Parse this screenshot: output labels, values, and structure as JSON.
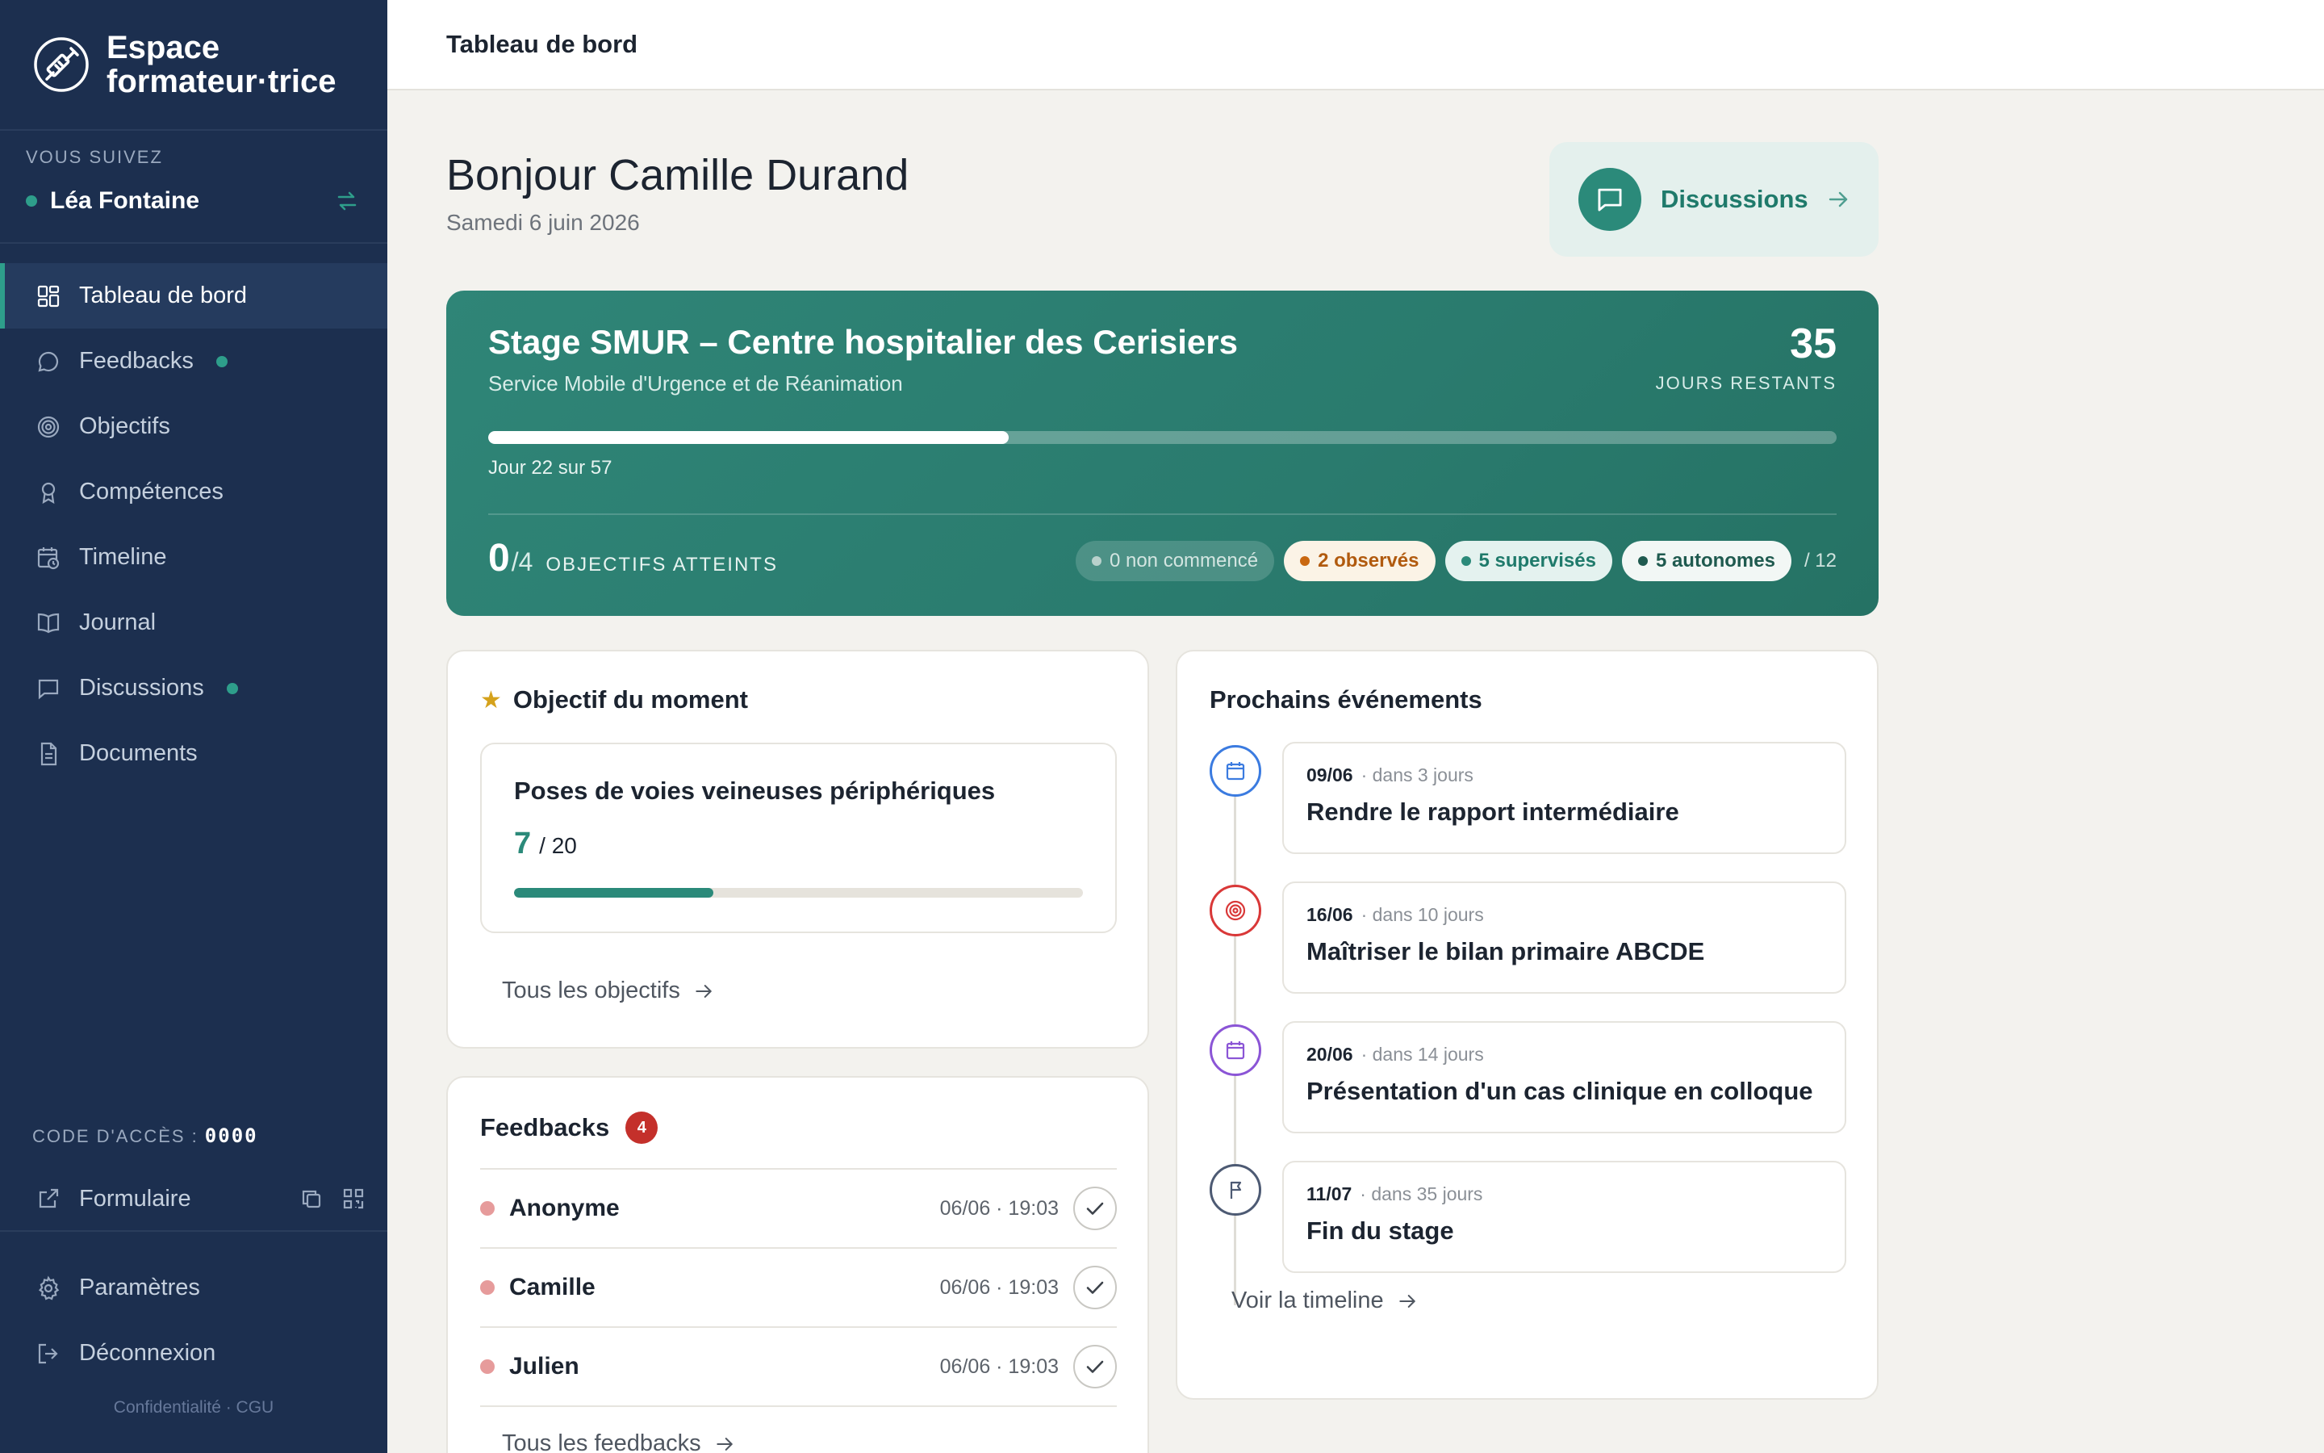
{
  "brand": {
    "line1": "Espace",
    "line2": "formateur·trice"
  },
  "follow": {
    "label": "VOUS SUIVEZ",
    "name": "Léa Fontaine"
  },
  "nav": [
    {
      "label": "Tableau de bord",
      "icon": "grid-icon"
    },
    {
      "label": "Feedbacks",
      "icon": "chat-bubble-icon",
      "dot": true
    },
    {
      "label": "Objectifs",
      "icon": "target-icon"
    },
    {
      "label": "Compétences",
      "icon": "award-icon"
    },
    {
      "label": "Timeline",
      "icon": "calendar-clock-icon"
    },
    {
      "label": "Journal",
      "icon": "book-icon"
    },
    {
      "label": "Discussions",
      "icon": "message-square-icon",
      "dot": true
    },
    {
      "label": "Documents",
      "icon": "document-icon"
    }
  ],
  "access": {
    "label": "CODE D'ACCÈS :",
    "code": "0000"
  },
  "formulaire": {
    "label": "Formulaire"
  },
  "bottom_nav": [
    {
      "label": "Paramètres",
      "icon": "gear-icon"
    },
    {
      "label": "Déconnexion",
      "icon": "logout-icon"
    }
  ],
  "legal": "Confidentialité · CGU",
  "topbar": {
    "title": "Tableau de bord"
  },
  "greeting": {
    "title": "Bonjour Camille Durand",
    "date": "Samedi 6 juin 2026"
  },
  "discussions_button": {
    "label": "Discussions"
  },
  "stage": {
    "title": "Stage SMUR – Centre hospitalier des Cerisiers",
    "subtitle": "Service Mobile d'Urgence et de Réanimation",
    "days_remaining": "35",
    "days_label": "JOURS RESTANTS",
    "day_current": 22,
    "day_total": 57,
    "day_text": "Jour 22 sur 57",
    "objectives_reached": "0",
    "objectives_total": "/4",
    "objectives_label": "OBJECTIFS ATTEINTS",
    "pills": {
      "not_started": "0 non commencé",
      "observed": "2 observés",
      "supervised": "5 supervisés",
      "autonomous": "5 autonomes",
      "total": "/ 12"
    }
  },
  "objective_card": {
    "title": "Objectif du moment",
    "item_title": "Poses de voies veineuses périphériques",
    "done": "7",
    "total": "/ 20",
    "progress": 0.35,
    "link": "Tous les objectifs"
  },
  "feedback_card": {
    "title": "Feedbacks",
    "count": "4",
    "items": [
      {
        "name": "Anonyme",
        "time": "06/06 · 19:03"
      },
      {
        "name": "Camille",
        "time": "06/06 · 19:03"
      },
      {
        "name": "Julien",
        "time": "06/06 · 19:03"
      }
    ],
    "link": "Tous les feedbacks"
  },
  "events_card": {
    "title": "Prochains événements",
    "items": [
      {
        "date": "09/06",
        "in": "· dans 3 jours",
        "title": "Rendre le rapport intermédiaire",
        "icon": "calendar-icon",
        "color": "#3b7be0"
      },
      {
        "date": "16/06",
        "in": "· dans 10 jours",
        "title": "Maîtriser le bilan primaire ABCDE",
        "icon": "target-icon",
        "color": "#d93838"
      },
      {
        "date": "20/06",
        "in": "· dans 14 jours",
        "title": "Présentation d'un cas clinique en colloque",
        "icon": "calendar-icon",
        "color": "#8b55d6"
      },
      {
        "date": "11/07",
        "in": "· dans 35 jours",
        "title": "Fin du stage",
        "icon": "flag-icon",
        "color": "#4d5a73"
      }
    ],
    "link": "Voir la timeline"
  },
  "colors": {
    "accent": "#2b8a7a",
    "sidebar": "#1c2f4f",
    "danger": "#c4302b"
  }
}
